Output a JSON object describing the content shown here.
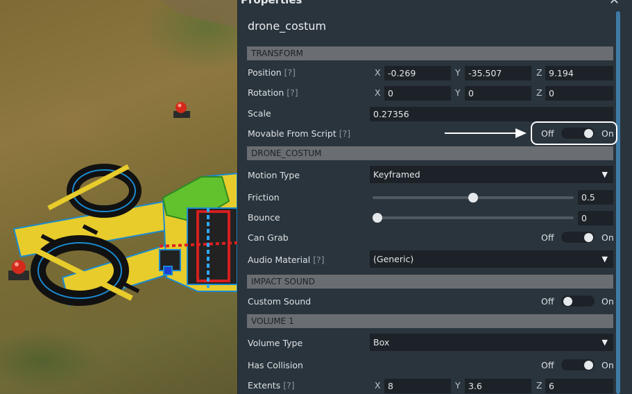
{
  "panel": {
    "title": "Properties",
    "object_name": "drone_costum"
  },
  "hint_text": "[?]",
  "transform": {
    "header": "TRANSFORM",
    "position": {
      "label": "Position",
      "x": "-0.269",
      "y": "-35.507",
      "z": "9.194"
    },
    "rotation": {
      "label": "Rotation",
      "x": "0",
      "y": "0",
      "z": "0"
    },
    "scale": {
      "label": "Scale",
      "value": "0.27356"
    },
    "movable": {
      "label": "Movable From Script",
      "off": "Off",
      "on": "On",
      "state": "on"
    }
  },
  "axes": {
    "x": "X",
    "y": "Y",
    "z": "Z"
  },
  "drone_costum": {
    "header": "DRONE_COSTUM",
    "motion_type": {
      "label": "Motion Type",
      "value": "Keyframed"
    },
    "friction": {
      "label": "Friction",
      "value": "0.5",
      "fraction": 0.5
    },
    "bounce": {
      "label": "Bounce",
      "value": "0",
      "fraction": 0
    },
    "can_grab": {
      "label": "Can Grab",
      "off": "Off",
      "on": "On",
      "state": "on"
    },
    "audio_material": {
      "label": "Audio Material",
      "value": "(Generic)"
    }
  },
  "impact_sound": {
    "header": "IMPACT SOUND",
    "custom_sound": {
      "label": "Custom Sound",
      "off": "Off",
      "on": "On",
      "state": "off"
    }
  },
  "volume1": {
    "header": "VOLUME 1",
    "volume_type": {
      "label": "Volume Type",
      "value": "Box"
    },
    "has_collision": {
      "label": "Has Collision",
      "off": "Off",
      "on": "On",
      "state": "on"
    },
    "extents": {
      "label": "Extents",
      "x": "8",
      "y": "3.6",
      "z": "6"
    }
  },
  "icons": {
    "close": "close-icon",
    "dropdown": "chevron-down-icon"
  },
  "colors": {
    "panel_bg": "#2a343c",
    "section_header": "#6a6e72",
    "field_bg": "#1c2227",
    "scrollbar": "#3e7aa5",
    "callout": "#ffffff"
  }
}
